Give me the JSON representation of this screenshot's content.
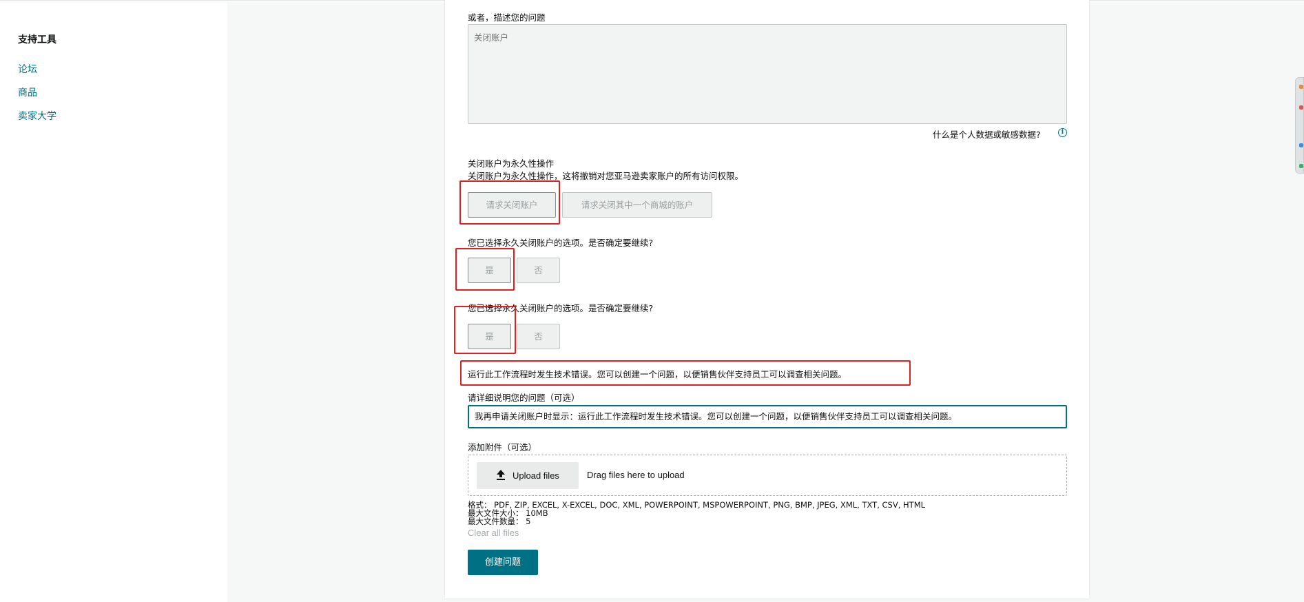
{
  "sidebar": {
    "title": "支持工具",
    "links": [
      "论坛",
      "商品",
      "卖家大学"
    ]
  },
  "form": {
    "describe_label": "或者，描述您的问题",
    "describe_value": "关闭账户",
    "sensitive_help": "什么是个人数据或敏感数据?",
    "info_icon": "i",
    "close_title": "关闭账户为永久性操作",
    "close_desc": "关闭账户为永久性操作，这将撤销对您亚马逊卖家账户的所有访问权限。",
    "request_close_button": "请求关闭账户",
    "request_close_store_button": "请求关闭其中一个商城的账户",
    "confirm_question_1": "您已选择永久关闭账户的选项。是否确定要继续?",
    "yes_1": "是",
    "no_1": "否",
    "confirm_question_2": "您已选择永久关闭账户的选项。是否确定要继续?",
    "yes_2": "是",
    "no_2": "否",
    "error_message": "运行此工作流程时发生技术错误。您可以创建一个问题，以便销售伙伴支持员工可以调查相关问题。",
    "detail_label": "请详细说明您的问题（可选）",
    "detail_value": "我再申请关闭账户时显示：运行此工作流程时发生技术错误。您可以创建一个问题，以便销售伙伴支持员工可以调查相关问题。",
    "attachment_label": "添加附件（可选）",
    "upload_button": "Upload files",
    "drag_text": "Drag files here to upload",
    "formats_line": "格式：  PDF, ZIP, EXCEL, X-EXCEL, DOC, XML, POWERPOINT, MSPOWERPOINT, PNG, BMP, JPEG, XML, TXT, CSV, HTML",
    "max_size_line": "最大文件大小：  10MB",
    "max_count_line": "最大文件数量：  5",
    "clear_files": "Clear all files",
    "create_button": "创建问题"
  },
  "colors": {
    "accent": "#007185",
    "annotation": "#e02020",
    "card_bg": "#ffffff",
    "page_bg": "#f6f7f7"
  },
  "icons": [
    "upload-icon",
    "info-icon"
  ]
}
